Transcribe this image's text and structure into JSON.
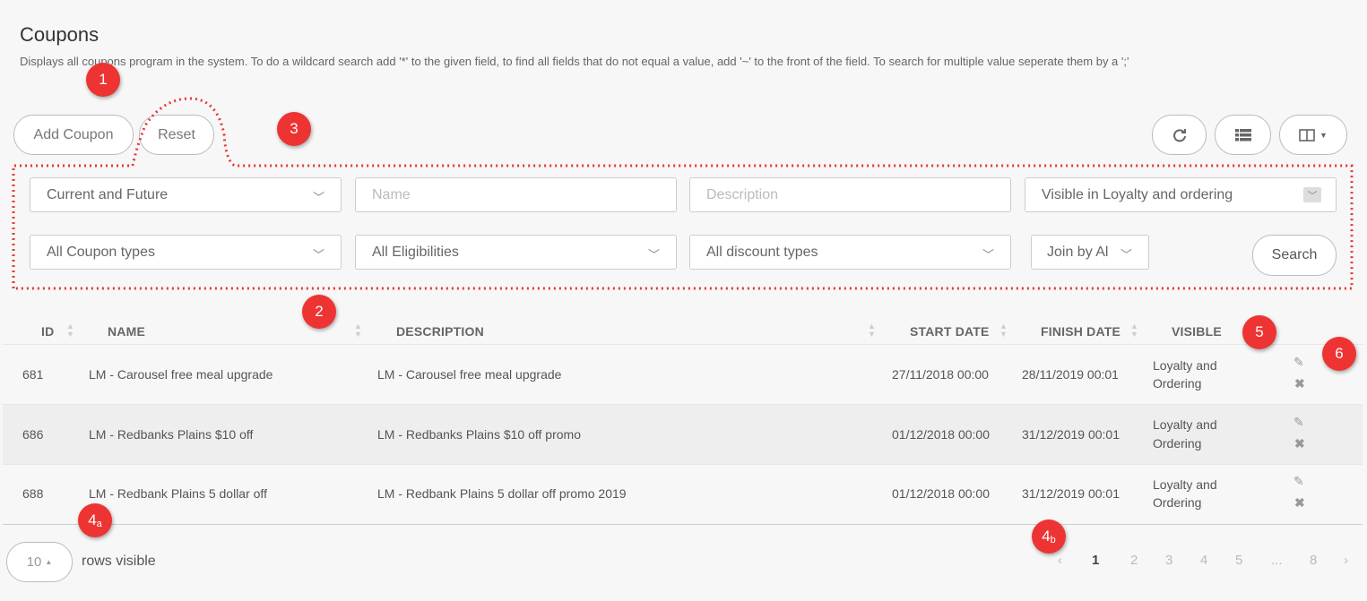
{
  "page": {
    "title": "Coupons",
    "subtitle": "Displays all coupons program in the system. To do a wildcard search add '*' to the given field, to find all fields that do not equal a value, add '~' to the front of the field. To search for multiple value seperate them by a ';'"
  },
  "toolbar": {
    "add_label": "Add Coupon",
    "reset_label": "Reset",
    "refresh_icon": "refresh-icon",
    "list_icon": "list-icon",
    "columns_icon": "columns-icon"
  },
  "filters": {
    "period": "Current and Future",
    "name_placeholder": "Name",
    "description_placeholder": "Description",
    "visibility": "Visible in Loyalty and ordering",
    "coupon_types": "All Coupon types",
    "eligibilities": "All Eligibilities",
    "discount_types": "All discount types",
    "join": "Join by Al",
    "search_label": "Search"
  },
  "table": {
    "headers": [
      "ID",
      "NAME",
      "DESCRIPTION",
      "START DATE",
      "FINISH DATE",
      "VISIBLE"
    ],
    "rows": [
      {
        "id": "681",
        "name": "LM - Carousel free meal upgrade",
        "description": "LM - Carousel free meal upgrade",
        "start": "27/11/2018 00:00",
        "finish": "28/11/2019 00:01",
        "visible_line1": "Loyalty and",
        "visible_line2": "Ordering"
      },
      {
        "id": "686",
        "name": "LM - Redbanks Plains $10 off",
        "description": "LM - Redbanks Plains $10 off promo",
        "start": "01/12/2018 00:00",
        "finish": "31/12/2019 00:01",
        "visible_line1": "Loyalty and",
        "visible_line2": "Ordering"
      },
      {
        "id": "688",
        "name": "LM - Redbank Plains 5 dollar off",
        "description": "LM - Redbank Plains 5 dollar off promo 2019",
        "start": "01/12/2018 00:00",
        "finish": "31/12/2019 00:01",
        "visible_line1": "Loyalty and",
        "visible_line2": "Ordering"
      }
    ]
  },
  "footer": {
    "rows_value": "10",
    "rows_label": "rows visible",
    "pages": [
      "1",
      "2",
      "3",
      "4",
      "5",
      "...",
      "8"
    ],
    "current_page": "1"
  },
  "markers": {
    "m1": "1",
    "m2": "2",
    "m3": "3",
    "m4a": "4",
    "m4a_sub": "a",
    "m4b": "4",
    "m4b_sub": "b",
    "m5": "5",
    "m6": "6"
  },
  "colors": {
    "marker": "#ee3333",
    "dotted_outline": "#e53935",
    "row_alt": "#eeeeee"
  }
}
